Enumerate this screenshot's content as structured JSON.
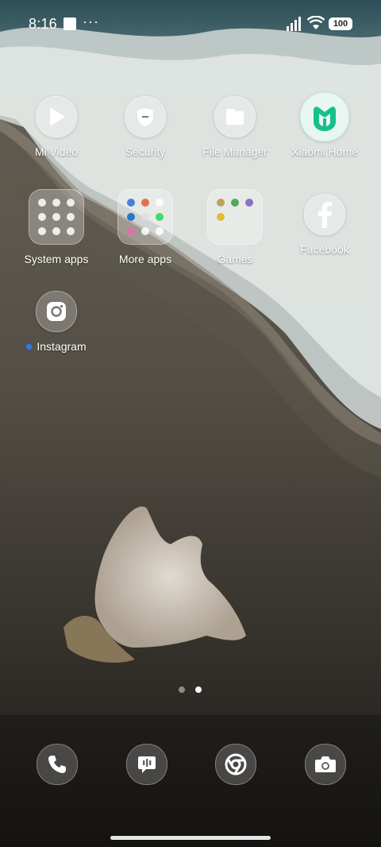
{
  "status_bar": {
    "time": "8:16",
    "notification_more": "···",
    "battery_level": "100"
  },
  "apps": [
    {
      "label": "Mi Video",
      "icon": "play-icon"
    },
    {
      "label": "Security",
      "icon": "shield-icon"
    },
    {
      "label": "File Manager",
      "icon": "folder-icon"
    },
    {
      "label": "Xiaomi Home",
      "icon": "mi-home-logo"
    },
    {
      "label": "System apps",
      "icon": "folder-group"
    },
    {
      "label": "More apps",
      "icon": "folder-group"
    },
    {
      "label": "Games",
      "icon": "folder-group"
    },
    {
      "label": "Facebook",
      "icon": "facebook-icon"
    },
    {
      "label": "Instagram",
      "icon": "instagram-icon",
      "new_indicator": true
    }
  ],
  "pager": {
    "pages": 2,
    "current": 2
  },
  "dock": [
    {
      "icon": "phone-icon"
    },
    {
      "icon": "messages-icon"
    },
    {
      "icon": "chrome-icon"
    },
    {
      "icon": "camera-icon"
    }
  ],
  "colors": {
    "accent_dot": "#2b7bff",
    "mi_home_green": "#17c08a"
  }
}
